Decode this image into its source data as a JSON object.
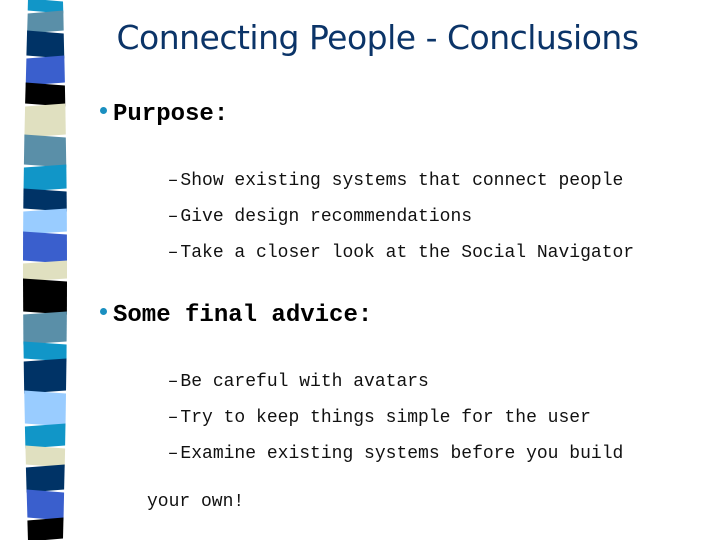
{
  "slide": {
    "title": "Connecting People - Conclusions",
    "sections": [
      {
        "heading": "Purpose:",
        "items": [
          "Show existing systems that connect people",
          "Give design recommendations",
          "Take a closer look at the Social Navigator"
        ]
      },
      {
        "heading": "Some final advice:",
        "items": [
          "Be careful with avatars",
          "Try to keep things simple for the user",
          "Examine existing systems before you build",
          "your own!"
        ]
      }
    ],
    "bullet_color": "#1a8fc0",
    "title_color": "#0b3468",
    "sub_bullet_glyph": "–"
  },
  "decoration": {
    "stripe_colors": [
      "#1196c8",
      "#5a8fa8",
      "#003366",
      "#3a5fcd",
      "#000000",
      "#e0e0c0",
      "#5a8fa8",
      "#1196c8",
      "#003366",
      "#99ccff",
      "#3a5fcd",
      "#e0e0c0",
      "#000000",
      "#5a8fa8",
      "#1196c8",
      "#003366",
      "#99ccff",
      "#1196c8",
      "#e0e0c0",
      "#003366",
      "#3a5fcd",
      "#000000"
    ]
  }
}
